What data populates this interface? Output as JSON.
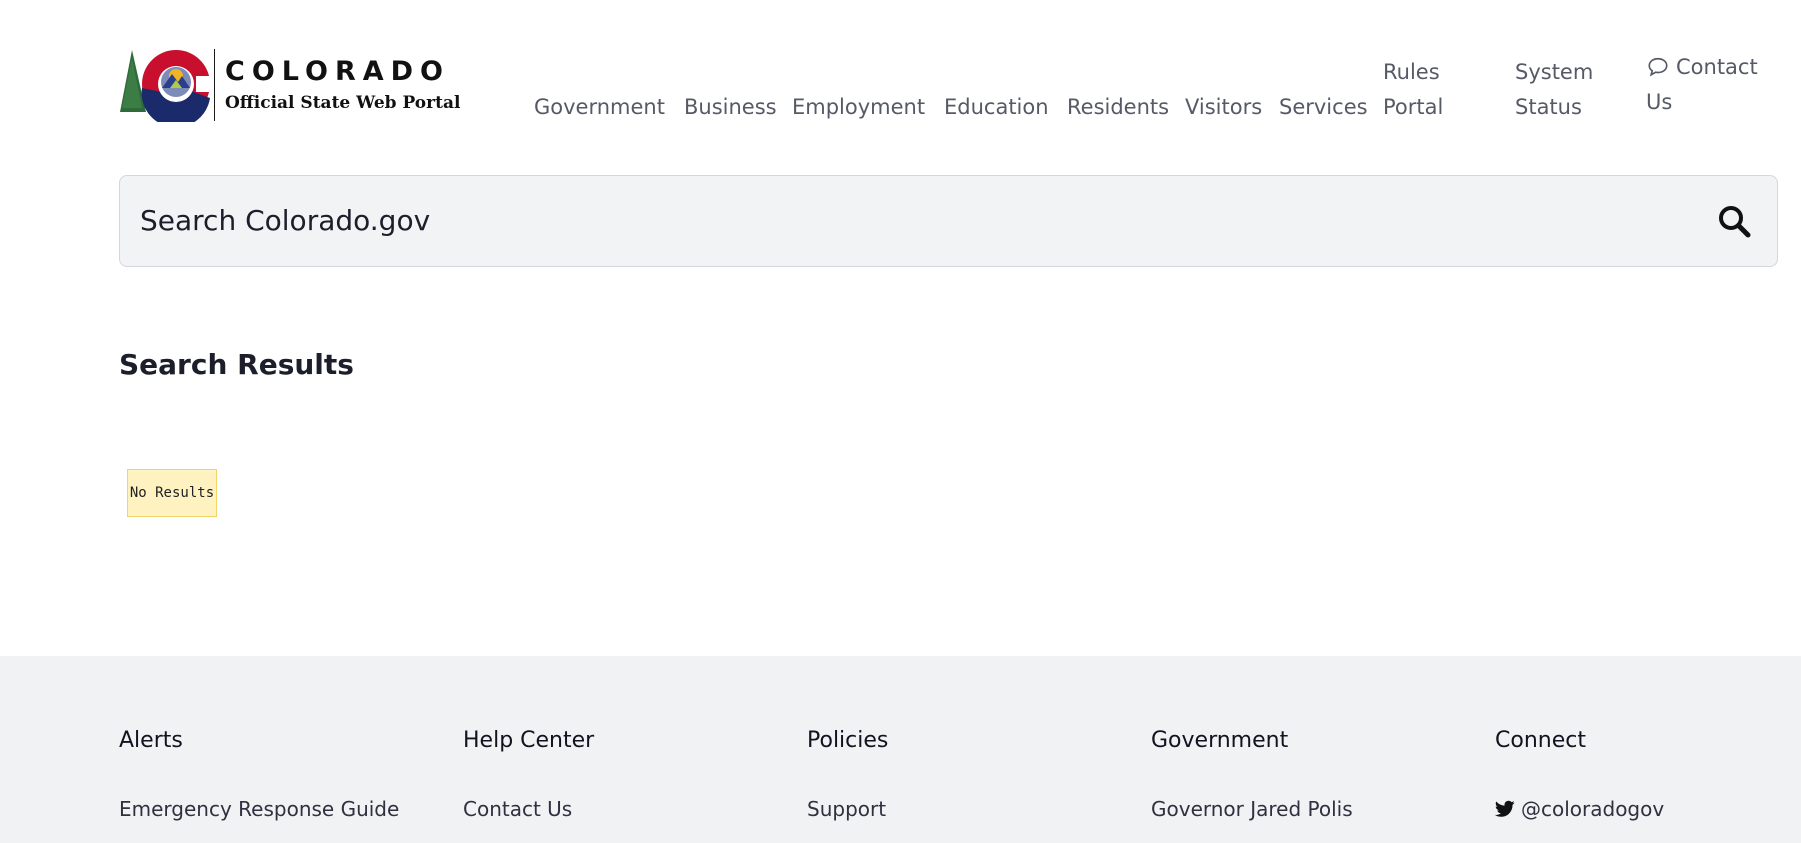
{
  "header": {
    "logo": {
      "title": "COLORADO",
      "subtitle": "Official State Web Portal"
    },
    "nav": [
      {
        "label": "Government"
      },
      {
        "label": "Business"
      },
      {
        "label": "Employment"
      },
      {
        "label": "Education"
      },
      {
        "label": "Residents"
      },
      {
        "label": "Visitors"
      },
      {
        "label": "Services"
      },
      {
        "label": "Rules Portal"
      },
      {
        "label": "System Status"
      },
      {
        "label": "Contact Us",
        "icon": "speech-bubble-icon"
      }
    ]
  },
  "search": {
    "placeholder": "Search Colorado.gov",
    "icon": "search-icon"
  },
  "results": {
    "heading": "Search Results",
    "empty_message": "No Results"
  },
  "footer": {
    "columns": [
      {
        "heading": "Alerts",
        "link": "Emergency Response Guide"
      },
      {
        "heading": "Help Center",
        "link": "Contact Us"
      },
      {
        "heading": "Policies",
        "link": "Support"
      },
      {
        "heading": "Government",
        "link": "Governor Jared Polis"
      },
      {
        "heading": "Connect",
        "link": "@coloradogov",
        "icon": "twitter-icon"
      }
    ]
  },
  "colors": {
    "footer_bg": "#f1f2f4",
    "search_bg": "#f2f3f5",
    "notice_bg": "#fef3c0",
    "notice_border": "#f1d36a",
    "logo_red": "#c8102e",
    "logo_blue": "#1b2a6b",
    "logo_gold": "#f0b429",
    "logo_green": "#2e6b3a"
  }
}
